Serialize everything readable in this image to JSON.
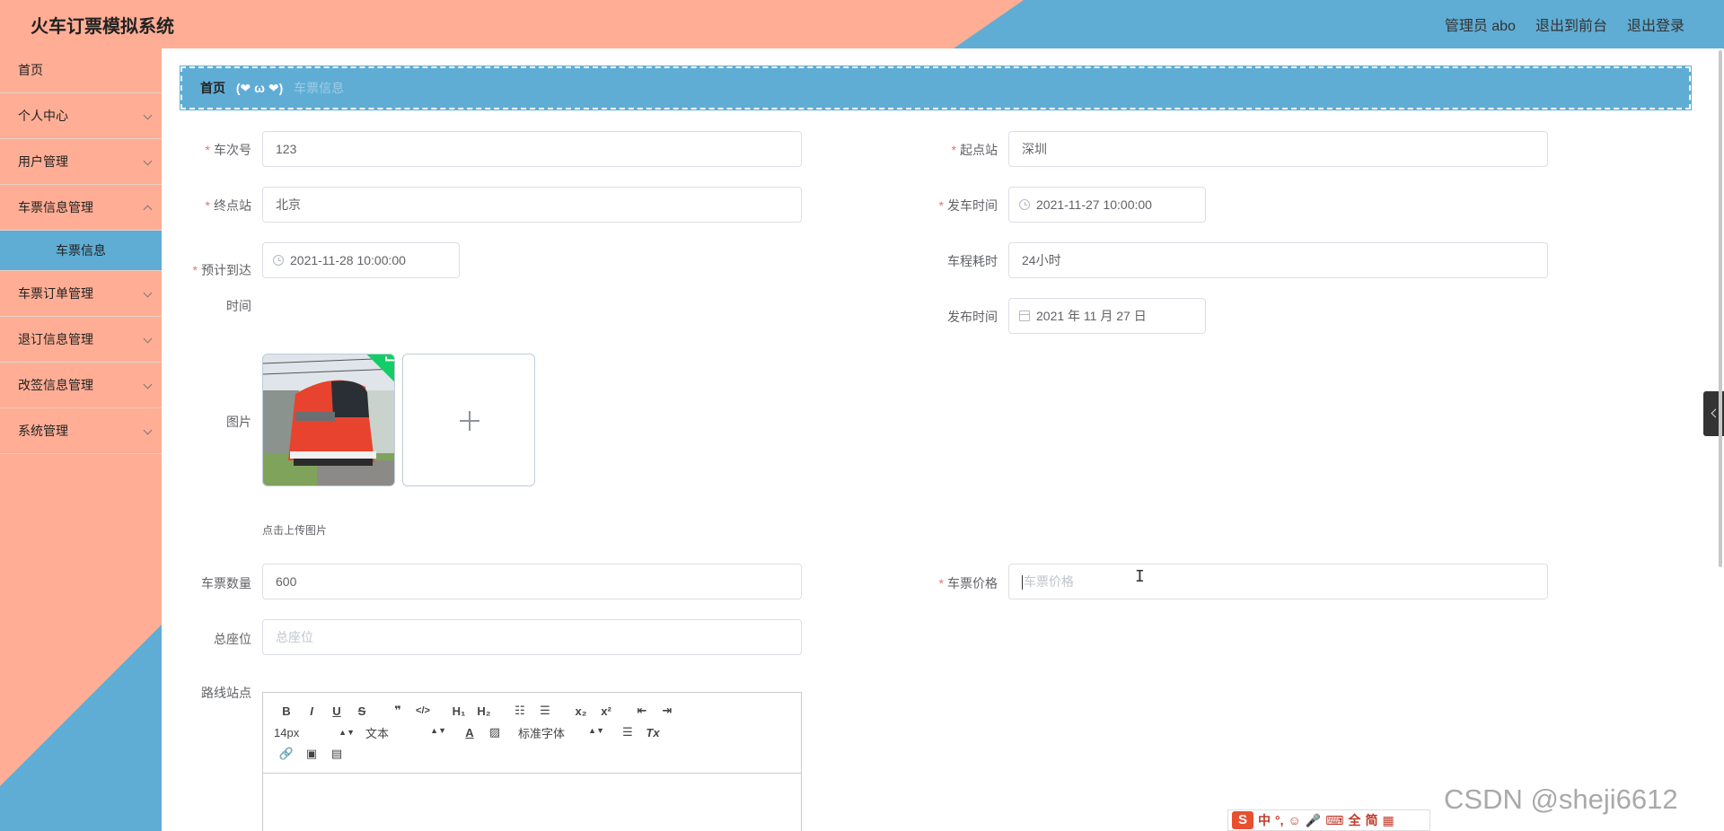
{
  "header": {
    "title": "火车订票模拟系统",
    "nav": [
      "管理员 abo",
      "退出到前台",
      "退出登录"
    ]
  },
  "sidebar": {
    "items": [
      {
        "label": "首页",
        "expandable": false
      },
      {
        "label": "个人中心",
        "expandable": true
      },
      {
        "label": "用户管理",
        "expandable": true
      },
      {
        "label": "车票信息管理",
        "expandable": true
      },
      {
        "label": "车票订单管理",
        "expandable": true
      },
      {
        "label": "退订信息管理",
        "expandable": true
      },
      {
        "label": "改签信息管理",
        "expandable": true
      },
      {
        "label": "系统管理",
        "expandable": true
      }
    ],
    "active_sub": "车票信息"
  },
  "breadcrumb": {
    "home": "首页",
    "separator": "(❤ ω ❤)",
    "current": "车票信息"
  },
  "form": {
    "train_no": {
      "label": "车次号",
      "value": "123"
    },
    "start_station": {
      "label": "起点站",
      "value": "深圳"
    },
    "end_station": {
      "label": "终点站",
      "value": "北京"
    },
    "depart_time": {
      "label": "发车时间",
      "value": "2021-11-27 10:00:00"
    },
    "arrive_time": {
      "label_line1": "预计到达",
      "label_line2": "时间",
      "value": "2021-11-28 10:00:00"
    },
    "duration": {
      "label": "车程耗时",
      "value": "24小时"
    },
    "publish_time": {
      "label": "发布时间",
      "value": "2021 年 11 月 27 日"
    },
    "image": {
      "label": "图片",
      "tip": "点击上传图片"
    },
    "ticket_count": {
      "label": "车票数量",
      "value": "600"
    },
    "ticket_price": {
      "label": "车票价格",
      "placeholder": "车票价格"
    },
    "total_seats": {
      "label": "总座位",
      "placeholder": "总座位"
    },
    "route_stations": {
      "label": "路线站点"
    }
  },
  "editor": {
    "font_size": "14px",
    "block_type": "文本",
    "font_family": "标准字体"
  },
  "ime": {
    "chars": [
      "中",
      "°,",
      "☺",
      "🎤",
      "⌨",
      "全",
      "简",
      "▦"
    ]
  },
  "watermark": "CSDN @sheji6612",
  "colors": {
    "salmon": "#ffae95",
    "blue": "#5fadd4",
    "required": "#f56c6c"
  }
}
